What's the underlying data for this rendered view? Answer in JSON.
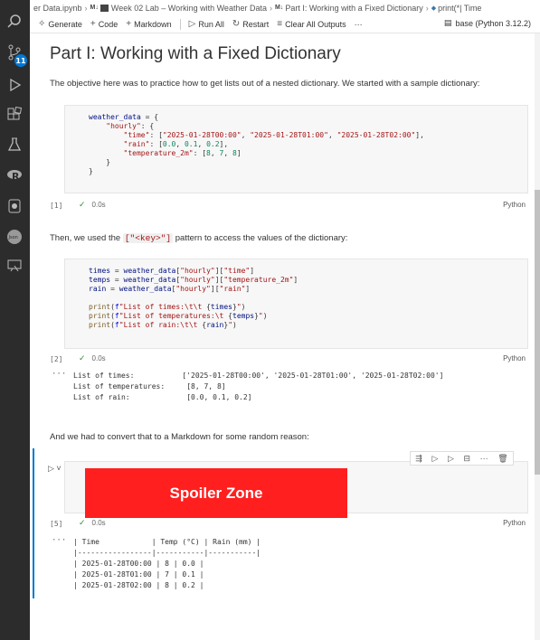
{
  "breadcrumb": {
    "file": "er Data.ipynb",
    "md_tag": "M↓",
    "week": "Week 02 Lab – Working with Weather Data",
    "part": "Part I: Working with a Fixed Dictionary",
    "symbol": "print(*| Time"
  },
  "toolbar": {
    "generate": "Generate",
    "code": "Code",
    "markdown": "Markdown",
    "run_all": "Run All",
    "restart": "Restart",
    "clear_all": "Clear All Outputs",
    "more": "···",
    "kernel": "base (Python 3.12.2)"
  },
  "activity": {
    "badge": "11"
  },
  "title": "Part I: Working with a Fixed Dictionary",
  "intro": "The objective here was to practice how to get lists out of a nested dictionary. We started with a sample dictionary:",
  "cell1": {
    "lines": [
      "weather_data = {",
      "    \"hourly\": {",
      "        \"time\": [\"2025-01-28T00:00\", \"2025-01-28T01:00\", \"2025-01-28T02:00\"],",
      "        \"rain\": [0.0, 0.1, 0.2],",
      "        \"temperature_2m\": [8, 7, 8]",
      "    }",
      "}"
    ],
    "exec": "[1]",
    "time": "0.0s",
    "lang": "Python"
  },
  "para2": {
    "before": "Then, we used the ",
    "code": "[\"<key>\"]",
    "after": " pattern to access the values of the dictionary:"
  },
  "cell2": {
    "lines": [
      "times = weather_data[\"hourly\"][\"time\"]",
      "temps = weather_data[\"hourly\"][\"temperature_2m\"]",
      "rain = weather_data[\"hourly\"][\"rain\"]",
      "",
      "print(f\"List of times:\\t\\t {times}\")",
      "print(f\"List of temperatures:\\t {temps}\")",
      "print(f\"List of rain:\\t\\t {rain}\")"
    ],
    "exec": "[2]",
    "time": "0.0s",
    "lang": "Python"
  },
  "output2": {
    "dots": "···",
    "lines": [
      "List of times:           ['2025-01-28T00:00', '2025-01-28T01:00', '2025-01-28T02:00']",
      "List of temperatures:     [8, 7, 8]",
      "List of rain:             [0.0, 0.1, 0.2]"
    ]
  },
  "para3": "And we had to convert that to a Markdown for some random reason:",
  "cell3": {
    "spoiler": "Spoiler Zone",
    "exec": "[5]",
    "time": "0.0s",
    "lang": "Python"
  },
  "output3": {
    "dots": "···",
    "lines": [
      "| Time            | Temp (°C) | Rain (mm) |",
      "|-----------------|-----------|-----------|",
      "| 2025-01-28T00:00 | 8 | 0.0 |",
      "| 2025-01-28T01:00 | 7 | 0.1 |",
      "| 2025-01-28T02:00 | 8 | 0.2 |"
    ]
  }
}
